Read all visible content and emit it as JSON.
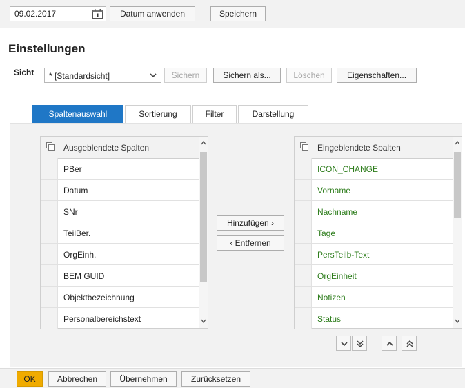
{
  "toolbar": {
    "date_value": "09.02.2017",
    "apply_date_label": "Datum anwenden",
    "save_label": "Speichern"
  },
  "page": {
    "title": "Einstellungen"
  },
  "view": {
    "label": "Sicht",
    "selected": "* [Standardsicht]",
    "save_label": "Sichern",
    "save_as_label": "Sichern als...",
    "delete_label": "Löschen",
    "properties_label": "Eigenschaften..."
  },
  "tabs": [
    {
      "label": "Spaltenauswahl",
      "active": true
    },
    {
      "label": "Sortierung",
      "active": false
    },
    {
      "label": "Filter",
      "active": false
    },
    {
      "label": "Darstellung",
      "active": false
    }
  ],
  "hidden_columns": {
    "header": "Ausgeblendete Spalten",
    "rows": [
      "PBer",
      "Datum",
      "SNr",
      "TeilBer.",
      "OrgEinh.",
      "BEM GUID",
      "Objektbezeichnung",
      "Personalbereichstext"
    ]
  },
  "shown_columns": {
    "header": "Eingeblendete Spalten",
    "rows": [
      "ICON_CHANGE",
      "Vorname",
      "Nachname",
      "Tage",
      "PersTeilb-Text",
      "OrgEinheit",
      "Notizen",
      "Status"
    ]
  },
  "transfer": {
    "add_label": "Hinzufügen ›",
    "remove_label": "‹ Entfernen"
  },
  "footer": {
    "ok_label": "OK",
    "cancel_label": "Abbrechen",
    "apply_label": "Übernehmen",
    "reset_label": "Zurücksetzen"
  },
  "colors": {
    "accent": "#1f77c6",
    "ok_button": "#f0ab00",
    "shown_text": "#2e7d1c"
  }
}
